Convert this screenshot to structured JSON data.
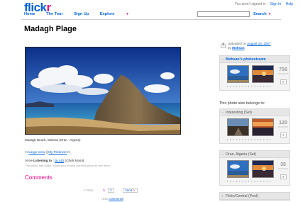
{
  "header": {
    "logo_main": "flick",
    "logo_accent": "r",
    "signed_out_text": "You aren't signed in",
    "sign_in": "Sign In",
    "help": "Help",
    "nav": [
      "Home",
      "The Tour",
      "Sign Up",
      "Explore"
    ],
    "search_label": "Search",
    "search_value": ""
  },
  "photo": {
    "title": "Madagh Plage",
    "caption": "Madagh Beach, Wahran (Oran - Algeria)"
  },
  "description": {
    "prefix": ">>",
    "large_view": "Large View",
    "separator": " || ",
    "my_flickriver": "My Flickriver",
    "suffix": "<<",
    "listening_label": ">>>> Listening to : ",
    "song_link": "BLADI",
    "artist": " (Cheb Mami)",
    "notes_hint": "This photo has notes. Move your mouse over the photo to see them."
  },
  "comments": {
    "heading": "Comments",
    "prev": "< Prev",
    "current_page": "1",
    "page2": "2",
    "next": "Next",
    "count_prefix": "(144 ",
    "count_link": "comments",
    "count_suffix": ")"
  },
  "sidebar": {
    "uploaded_prefix": "Uploaded on ",
    "uploaded_date": "August 16, 2007",
    "by_prefix": "by ",
    "uploader": "Mohsan",
    "belongs_heading": "This photo also belongs to:",
    "panels": [
      {
        "title": "Mohsan's photostream",
        "count": "756",
        "count_unit": "UPLOADS",
        "dots": "▪ ▪ ▪ ▪ ▪ ▪ ▪ ▪ ▪ ▪ ▪ ▪ ▪ ▪ ▪"
      },
      {
        "title": "Interesting (Set)",
        "count": "120",
        "count_unit": "PHOTOS",
        "dots": "▪ ▪ ▪ ▪ ▪ ▪ ▪ ▪ ▪ ▪ ▪ ▪ ▪ ▪ ▪"
      },
      {
        "title": "Oran, Algeria (Set)",
        "count": "35",
        "count_unit": "PHOTOS",
        "dots": "▪ ▪ ▪ ▪ ▪ ▪ ▪ ▪ ▪ ▪ ▪ ▪ ▪ ▪ ▪"
      },
      {
        "title": "Flickr/Central (Pool)"
      }
    ]
  },
  "colors": {
    "flickr_blue": "#0063dc",
    "flickr_pink": "#ff0084"
  }
}
